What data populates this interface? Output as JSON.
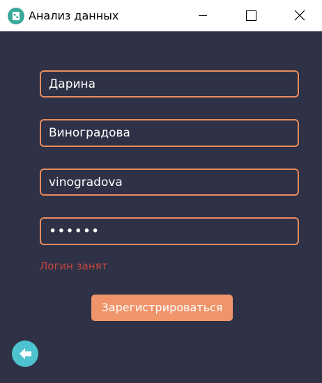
{
  "window": {
    "title": "Анализ данных",
    "icon": "app-grid-icon",
    "controls": [
      "minimize-icon",
      "maximize-icon",
      "close-icon"
    ]
  },
  "form": {
    "first_name": "Дарина",
    "last_name": "Виноградова",
    "login": "vinogradova",
    "password": "••••••",
    "error": "Логин занят",
    "submit_label": "Зарегистрироваться",
    "back_icon": "arrow-left-icon"
  },
  "colors": {
    "background": "#2f3146",
    "field_border": "#e88c5e",
    "error_text": "#c3463f",
    "button": "#f0946a",
    "back_button": "#4ec3cf",
    "app_icon": "#3aaa9b"
  }
}
